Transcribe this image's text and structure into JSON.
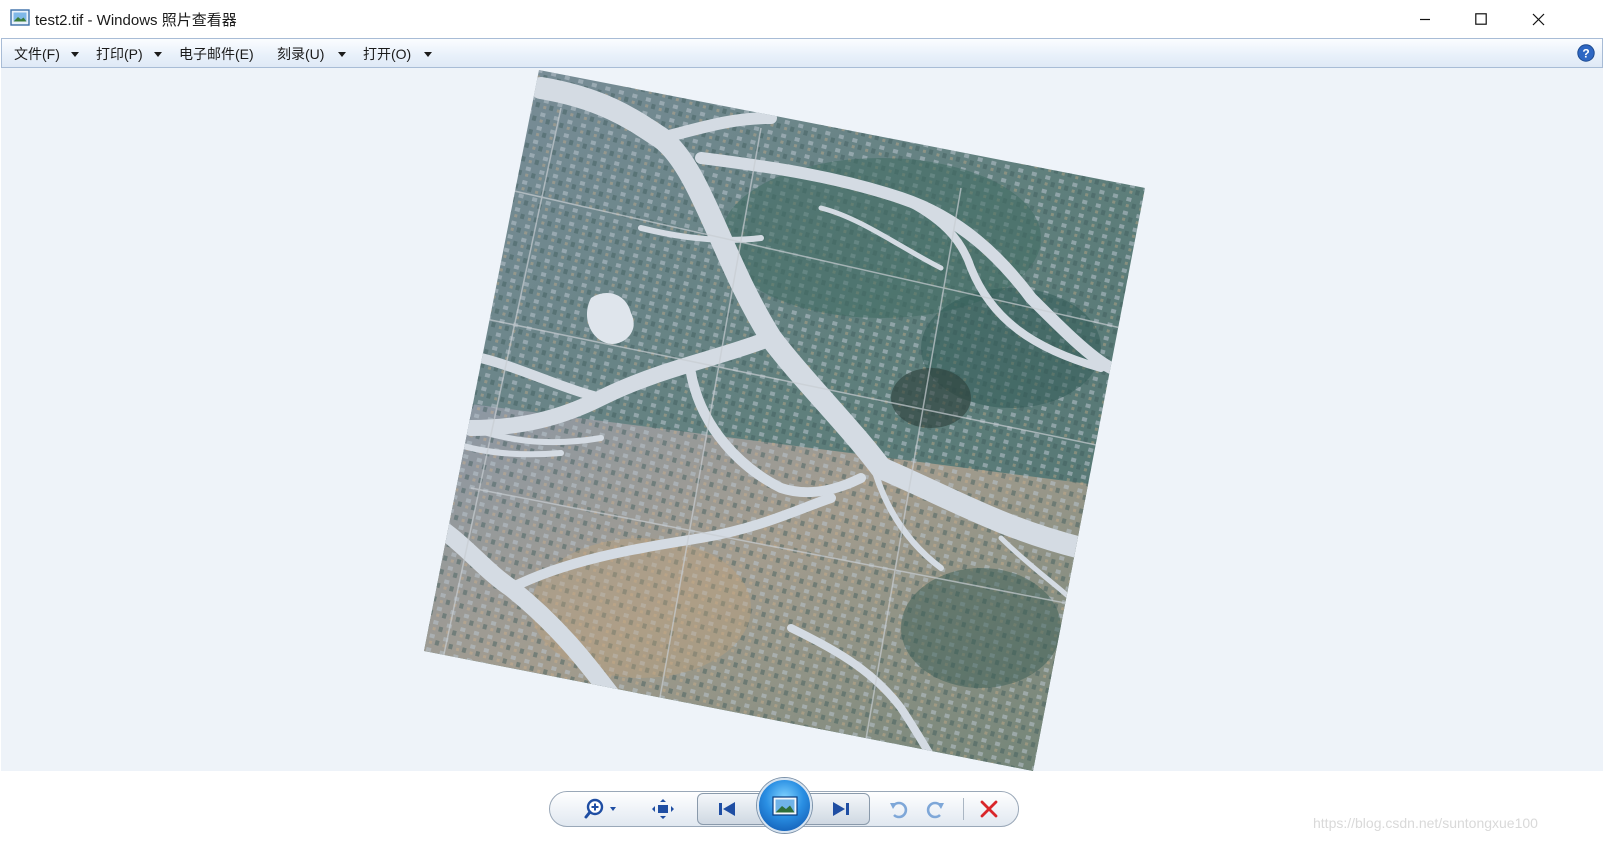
{
  "window": {
    "title": "test2.tif - Windows 照片查看器",
    "app_icon": "photo-viewer-icon",
    "controls": [
      "minimize-icon",
      "maximize-icon",
      "close-icon"
    ]
  },
  "menu": {
    "items": [
      {
        "label": "文件(F)",
        "has_dropdown": true
      },
      {
        "label": "打印(P)",
        "has_dropdown": true
      },
      {
        "label": "电子邮件(E)",
        "has_dropdown": false
      },
      {
        "label": "刻录(U)",
        "has_dropdown": true
      },
      {
        "label": "打开(O)",
        "has_dropdown": true
      }
    ],
    "help_icon": "help-icon"
  },
  "viewer": {
    "background_color": "#eef3f9",
    "image_description_icon": "satellite-image"
  },
  "controls": {
    "zoom": "zoom-icon",
    "actual_size": "fit-window-icon",
    "previous": "previous-icon",
    "slideshow": "slideshow-icon",
    "next": "next-icon",
    "rotate_ccw": "rotate-counterclockwise-icon",
    "rotate_cw": "rotate-clockwise-icon",
    "delete": "delete-icon"
  },
  "watermark": "https://blog.csdn.net/suntongxue100",
  "colors": {
    "menu_bar_border": "#a8bcd6",
    "delete_red": "#d9262a",
    "nav_blue": "#1f4ea3",
    "river": "#d4dbe3"
  }
}
